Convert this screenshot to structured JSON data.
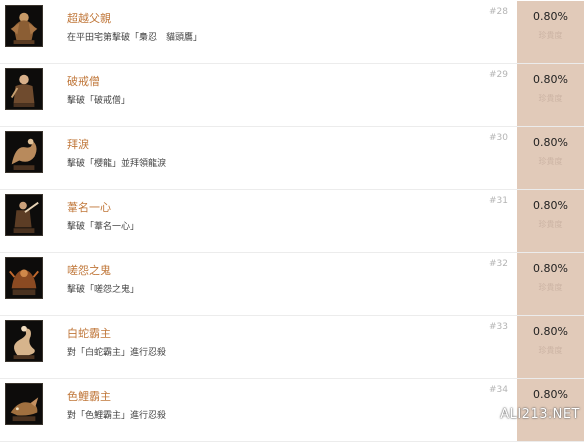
{
  "achievements": [
    {
      "title": "超越父親",
      "description": "在平田宅第擊破「梟忍　貓頭鷹」",
      "number": "#28",
      "percent": "0.80%",
      "percent_label": "珍貴度",
      "icon": "owl-boss-icon"
    },
    {
      "title": "破戒僧",
      "description": "擊破「破戒僧」",
      "number": "#29",
      "percent": "0.80%",
      "percent_label": "珍貴度",
      "icon": "corrupted-monk-icon"
    },
    {
      "title": "拜淚",
      "description": "擊破「櫻龍」並拜領龍淚",
      "number": "#30",
      "percent": "0.80%",
      "percent_label": "珍貴度",
      "icon": "divine-dragon-icon"
    },
    {
      "title": "葦名一心",
      "description": "擊破「葦名一心」",
      "number": "#31",
      "percent": "0.80%",
      "percent_label": "珍貴度",
      "icon": "isshin-icon"
    },
    {
      "title": "嗟怨之鬼",
      "description": "擊破「嗟怨之鬼」",
      "number": "#32",
      "percent": "0.80%",
      "percent_label": "珍貴度",
      "icon": "demon-of-hatred-icon"
    },
    {
      "title": "白蛇霸主",
      "description": "對「白蛇霸主」進行忍殺",
      "number": "#33",
      "percent": "0.80%",
      "percent_label": "珍貴度",
      "icon": "white-serpent-icon"
    },
    {
      "title": "色鯉霸主",
      "description": "對「色鯉霸主」進行忍殺",
      "number": "#34",
      "percent": "0.80%",
      "percent_label": "珍貴度",
      "icon": "carp-icon"
    }
  ],
  "watermark": "ALI213.NET"
}
